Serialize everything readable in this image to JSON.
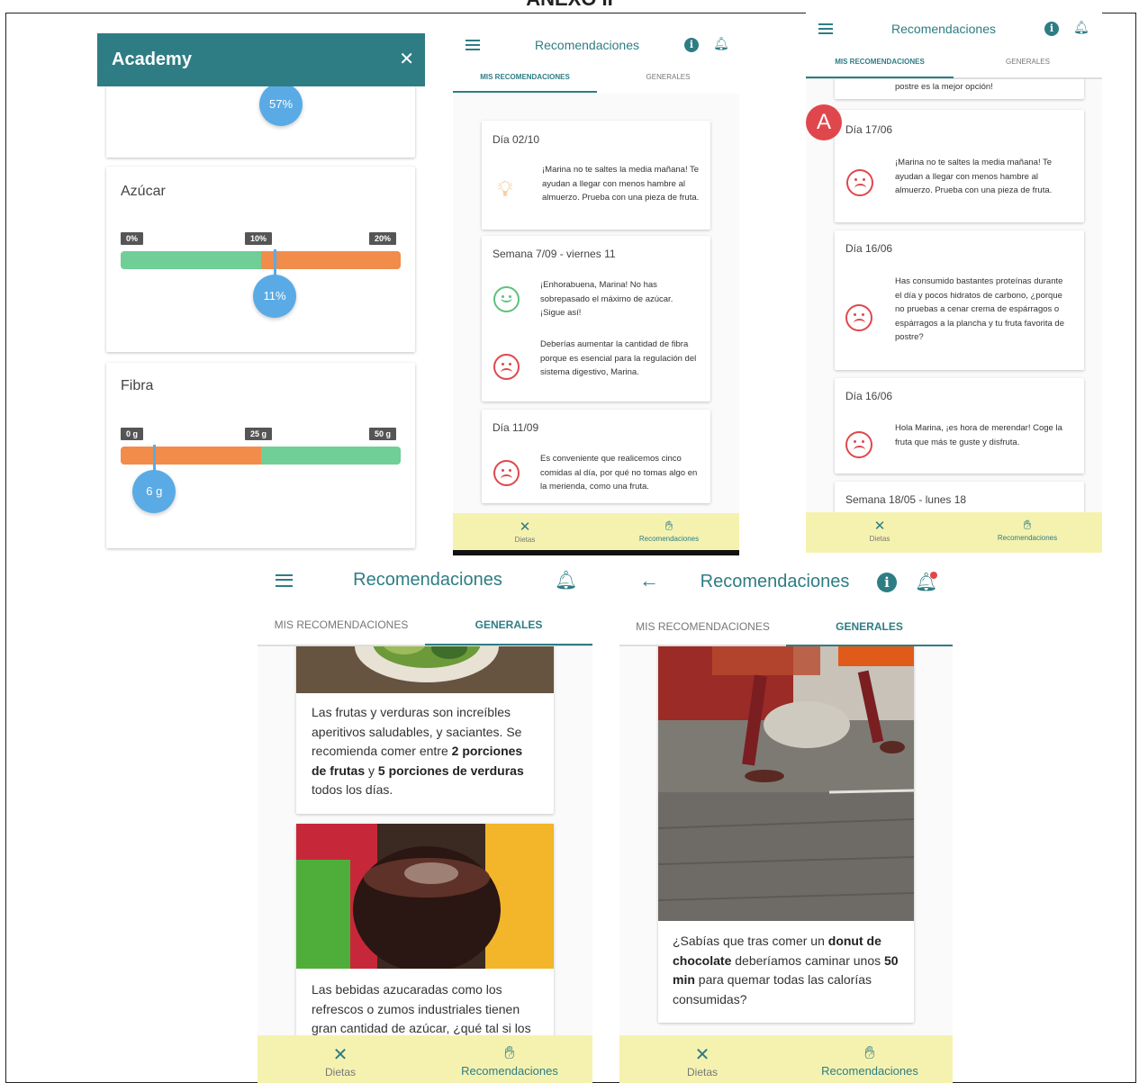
{
  "page_heading": "ANEXO II",
  "academy": {
    "title": "Academy",
    "close_icon": "close-icon",
    "top_bubble": "57%",
    "sugar": {
      "label": "Azúcar",
      "ticks": [
        "0%",
        "10%",
        "20%"
      ],
      "value_label": "11%",
      "value_fraction": 0.55
    },
    "fiber": {
      "label": "Fibra",
      "ticks": [
        "0 g",
        "25 g",
        "50 g"
      ],
      "value_label": "6 g",
      "value_fraction": 0.12
    }
  },
  "app": {
    "title": "Recomendaciones",
    "tab_mine": "MIS RECOMENDACIONES",
    "tab_general": "GENERALES",
    "nav_diets": "Dietas",
    "nav_recs": "Recomendaciones"
  },
  "screen2": {
    "cards": [
      {
        "title": "Día 02/10",
        "items": [
          {
            "icon": "lightbulb-icon",
            "text": "¡Marina no te  saltes la media mañana! Te ayudan a llegar con menos hambre al almuerzo. Prueba con una pieza de fruta."
          }
        ]
      },
      {
        "title": "Semana 7/09 - viernes 11",
        "items": [
          {
            "icon": "happy-face-icon",
            "text": "¡Enhorabuena, Marina! No has sobrepasado el máximo de azúcar. ¡Sigue así!"
          },
          {
            "icon": "sad-face-icon",
            "text": "Deberías aumentar la cantidad de fibra porque es esencial para la regulación del sistema digestivo, Marina."
          }
        ]
      },
      {
        "title": "Día 11/09",
        "items": [
          {
            "icon": "sad-face-icon",
            "text": "Es conveniente que realicemos cinco comidas al día, por qué no tomas algo en la merienda, como una fruta."
          }
        ]
      }
    ]
  },
  "screen3": {
    "top_fragment": "postre es la mejor opción!",
    "avatar_letter": "A",
    "cards": [
      {
        "title": "Día 17/06",
        "text": "¡Marina no te  saltes la media mañana! Te ayudan a llegar con menos hambre al almuerzo. Prueba con una pieza de fruta."
      },
      {
        "title": "Día 16/06",
        "text": "Has consumido bastantes proteínas durante el día y pocos hidratos de carbono, ¿porque no pruebas a cenar crema de espárragos o espárragos a la plancha y tu fruta favorita de postre?"
      },
      {
        "title": "Día 16/06",
        "text": "Hola Marina, ¡es hora de merendar! Coge la fruta que más te guste y disfruta."
      }
    ],
    "last_title": "Semana 18/05 - lunes 18"
  },
  "screen4": {
    "text1_a": "Las frutas y verduras son increíbles aperitivos saludables, y saciantes. Se recomienda comer entre ",
    "text1_b1": "2 porciones de frutas",
    "text1_c": " y ",
    "text1_b2": "5 porciones de verduras",
    "text1_d": " todos los días.",
    "text2": "Las bebidas azucaradas como los refrescos o zumos industriales tienen gran cantidad de azúcar, ¿qué tal si los"
  },
  "screen5": {
    "text_a": "¿Sabías que tras comer un ",
    "text_b1": "donut de chocolate",
    "text_c": " deberíamos caminar unos ",
    "text_b2": "50 min",
    "text_d": " para quemar todas las calorías consumidas?"
  },
  "colors": {
    "teal": "#2e7d84",
    "nav_bg": "#f5f2b0",
    "green": "#6fcf97",
    "orange": "#f28c4b",
    "bubble": "#5aabe5",
    "sad": "#e0474c",
    "happy": "#5ec27a",
    "bulb": "#f0a35a"
  }
}
